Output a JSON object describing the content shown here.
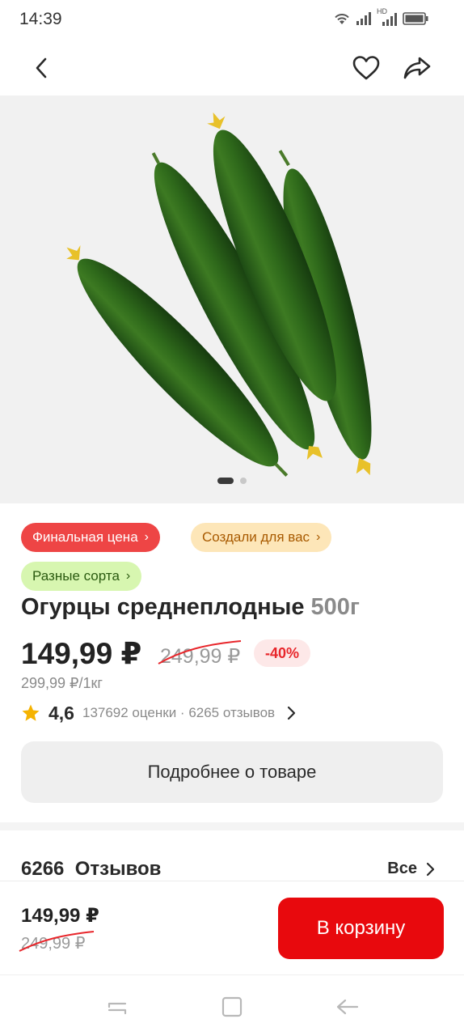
{
  "status_bar": {
    "time": "14:39",
    "icons": [
      "wifi-icon",
      "signal-icon",
      "hd-signal-icon",
      "battery-icon"
    ],
    "hd_label": "HD"
  },
  "app_bar": {
    "back_icon": "chevron-left-icon",
    "favorite_icon": "heart-icon",
    "share_icon": "share-icon"
  },
  "gallery": {
    "image": "cucumbers",
    "page_count": 2,
    "active_page": 1
  },
  "badges": {
    "final_price": "Финальная цена",
    "created_for_you": "Создали для вас",
    "varieties": "Разные сорта"
  },
  "product": {
    "name": "Огурцы среднеплодные",
    "weight": "500г",
    "price": "149,99 ₽",
    "old_price": "249,99 ₽",
    "discount": "-40%",
    "price_per_kg": "299,99 ₽/1кг",
    "rating": "4,6",
    "rating_meta": "137692 оценки · 6265 отзывов"
  },
  "details_button": "Подробнее о товаре",
  "reviews": {
    "count": "6266",
    "label": "Отзывов",
    "all_label": "Все"
  },
  "bottom_bar": {
    "price": "149,99 ₽",
    "old_price": "249,99 ₽",
    "cart_button": "В корзину"
  },
  "colors": {
    "accent_red": "#e8090d",
    "badge_final": "#ee4545",
    "badge_created": "#fde6b8",
    "badge_variety": "#d7f6b0",
    "star": "#f5b301"
  }
}
